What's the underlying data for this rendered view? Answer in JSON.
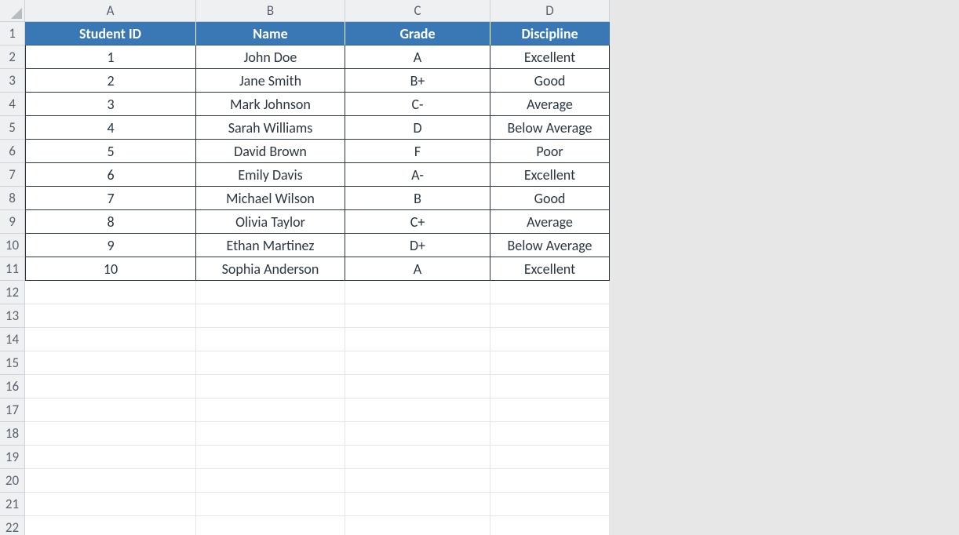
{
  "columns": [
    "A",
    "B",
    "C",
    "D"
  ],
  "total_visible_rows": 22,
  "header_row": {
    "row_num": 1,
    "cells": [
      "Student ID",
      "Name",
      "Grade",
      "Discipline"
    ]
  },
  "data_rows": [
    {
      "row_num": 2,
      "cells": [
        "1",
        "John Doe",
        "A",
        "Excellent"
      ]
    },
    {
      "row_num": 3,
      "cells": [
        "2",
        "Jane Smith",
        "B+",
        "Good"
      ]
    },
    {
      "row_num": 4,
      "cells": [
        "3",
        "Mark Johnson",
        "C-",
        "Average"
      ]
    },
    {
      "row_num": 5,
      "cells": [
        "4",
        "Sarah Williams",
        "D",
        "Below Average"
      ]
    },
    {
      "row_num": 6,
      "cells": [
        "5",
        "David Brown",
        "F",
        "Poor"
      ]
    },
    {
      "row_num": 7,
      "cells": [
        "6",
        "Emily Davis",
        "A-",
        "Excellent"
      ]
    },
    {
      "row_num": 8,
      "cells": [
        "7",
        "Michael Wilson",
        "B",
        "Good"
      ]
    },
    {
      "row_num": 9,
      "cells": [
        "8",
        "Olivia Taylor",
        "C+",
        "Average"
      ]
    },
    {
      "row_num": 10,
      "cells": [
        "9",
        "Ethan Martinez",
        "D+",
        "Below Average"
      ]
    },
    {
      "row_num": 11,
      "cells": [
        "10",
        "Sophia Anderson",
        "A",
        "Excellent"
      ]
    }
  ],
  "chart_data": {
    "type": "table",
    "title": "",
    "columns": [
      "Student ID",
      "Name",
      "Grade",
      "Discipline"
    ],
    "rows": [
      [
        1,
        "John Doe",
        "A",
        "Excellent"
      ],
      [
        2,
        "Jane Smith",
        "B+",
        "Good"
      ],
      [
        3,
        "Mark Johnson",
        "C-",
        "Average"
      ],
      [
        4,
        "Sarah Williams",
        "D",
        "Below Average"
      ],
      [
        5,
        "David Brown",
        "F",
        "Poor"
      ],
      [
        6,
        "Emily Davis",
        "A-",
        "Excellent"
      ],
      [
        7,
        "Michael Wilson",
        "B",
        "Good"
      ],
      [
        8,
        "Olivia Taylor",
        "C+",
        "Average"
      ],
      [
        9,
        "Ethan Martinez",
        "D+",
        "Below Average"
      ],
      [
        10,
        "Sophia Anderson",
        "A",
        "Excellent"
      ]
    ]
  }
}
